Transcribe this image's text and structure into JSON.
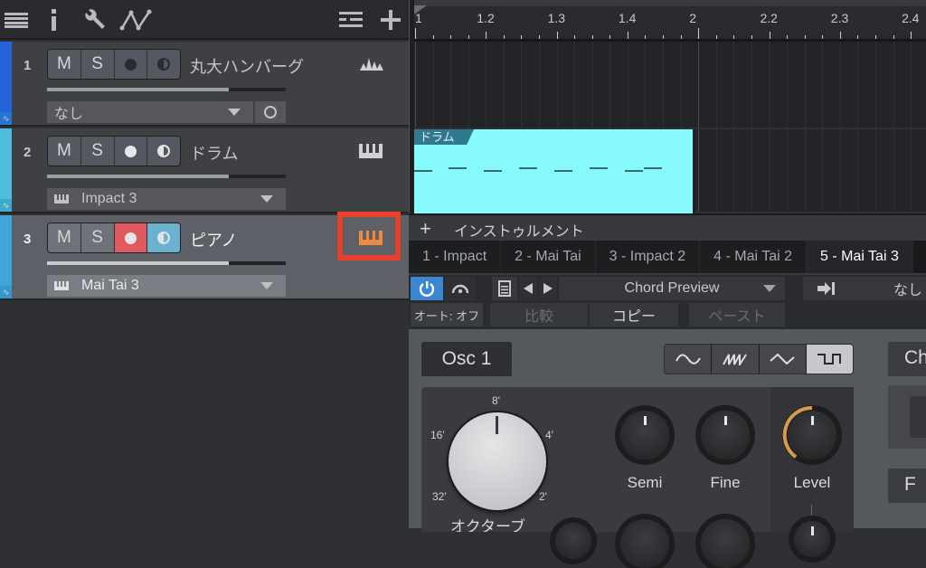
{
  "toolbar": {
    "icons": [
      "list-icon",
      "info-icon",
      "wrench-icon",
      "automation-icon"
    ],
    "right_icons": [
      "track-list-icon",
      "add-track-icon"
    ]
  },
  "tracks": [
    {
      "num": "1",
      "name": "丸大ハンバーグ",
      "color": "#2563d9",
      "armed": false,
      "monitor": false,
      "volume": 0.76,
      "select_value": "なし",
      "select_icon": "none",
      "type_icon": "audio-waveform-icon",
      "selected": false
    },
    {
      "num": "2",
      "name": "ドラム",
      "color": "#4fbde0",
      "armed": false,
      "monitor": false,
      "volume": 0.76,
      "select_value": "Impact 3",
      "select_icon": "keyboard-icon",
      "type_icon": "keyboard-icon",
      "selected": false
    },
    {
      "num": "3",
      "name": "ピアノ",
      "color": "#3fa6d9",
      "armed": true,
      "monitor": true,
      "volume": 0.76,
      "select_value": "Mai Tai 3",
      "select_icon": "keyboard-icon",
      "type_icon": "keyboard-icon",
      "selected": true,
      "highlight_color": "#e8402a",
      "type_icon_color": "#f08a3c"
    }
  ],
  "track_buttons": {
    "mute": "M",
    "solo": "S"
  },
  "ruler": {
    "labels": [
      "1",
      "1.2",
      "1.3",
      "1.4",
      "2",
      "2.2",
      "2.3",
      "2.4"
    ]
  },
  "clip": {
    "name": "ドラム",
    "color": "#86fafc"
  },
  "instrument_panel": {
    "title": "インストゥルメント",
    "tabs": [
      "1 - Impact",
      "2 - Mai Tai",
      "3 - Impact 2",
      "4 - Mai Tai 2",
      "5 - Mai Tai 3"
    ],
    "active_tab": 4,
    "preset": "Chord Preview",
    "sidechain_value": "なし",
    "auto_label": "オート: オフ",
    "compare": "比較",
    "copy": "コピー",
    "paste": "ペースト"
  },
  "synth": {
    "osc_label": "Osc 1",
    "waveforms": [
      "sine",
      "saw",
      "triangle",
      "square"
    ],
    "active_waveform": "square",
    "octave_labels": [
      "8'",
      "16'",
      "4'",
      "32'",
      "2'"
    ],
    "octave_name": "オクターブ",
    "knobs": [
      {
        "label": "Semi"
      },
      {
        "label": "Fine"
      },
      {
        "label": "Level",
        "value": 0.4
      }
    ],
    "right_button": "Ch",
    "right_button2": "F"
  }
}
